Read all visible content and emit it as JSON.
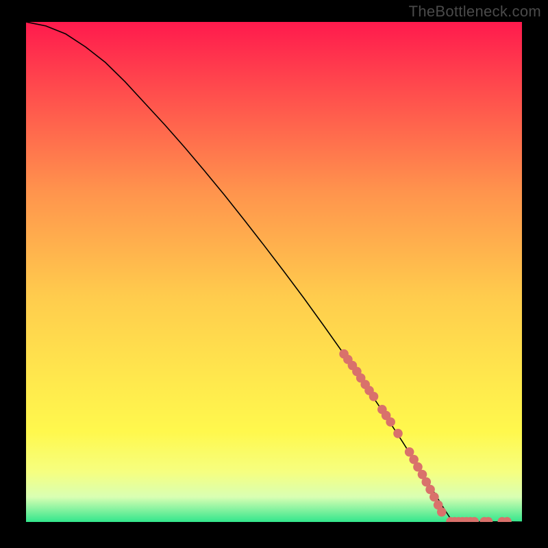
{
  "watermark": "TheBottleneck.com",
  "colors": {
    "bg_black": "#000000",
    "grad_top": "#ff1a4d",
    "grad_mid1": "#ff4d4d",
    "grad_mid2": "#ff944d",
    "grad_mid3": "#ffcc4d",
    "grad_mid4": "#ffe94d",
    "grad_mid5": "#fff84d",
    "grad_mid6": "#f6ff80",
    "grad_mid7": "#d9ffb3",
    "grad_bottom": "#33e68c",
    "curve": "#000000",
    "dots": "#d9716b"
  },
  "chart_data": {
    "type": "line",
    "title": "",
    "xlabel": "",
    "ylabel": "",
    "x_range": [
      0,
      100
    ],
    "y_range": [
      0,
      100
    ],
    "curve": [
      [
        0,
        100
      ],
      [
        4,
        99.2
      ],
      [
        8,
        97.6
      ],
      [
        12,
        95.0
      ],
      [
        16,
        91.9
      ],
      [
        20,
        88.0
      ],
      [
        24,
        83.7
      ],
      [
        28,
        79.4
      ],
      [
        32,
        74.9
      ],
      [
        36,
        70.2
      ],
      [
        40,
        65.4
      ],
      [
        44,
        60.4
      ],
      [
        48,
        55.3
      ],
      [
        52,
        50.1
      ],
      [
        56,
        44.8
      ],
      [
        60,
        39.3
      ],
      [
        64,
        33.7
      ],
      [
        68,
        27.9
      ],
      [
        72,
        22.0
      ],
      [
        76,
        15.9
      ],
      [
        80,
        9.6
      ],
      [
        82,
        6.4
      ],
      [
        84,
        3.1
      ],
      [
        85.5,
        0.8
      ],
      [
        86,
        0.3
      ],
      [
        88,
        0.1
      ],
      [
        92,
        0.05
      ],
      [
        96,
        0.02
      ],
      [
        100,
        0.0
      ]
    ],
    "upper_dot_cluster": [
      [
        64.1,
        33.6
      ],
      [
        64.9,
        32.5
      ],
      [
        65.8,
        31.3
      ],
      [
        66.7,
        30.1
      ],
      [
        67.5,
        28.8
      ],
      [
        68.4,
        27.5
      ],
      [
        69.2,
        26.3
      ],
      [
        70.1,
        25.1
      ],
      [
        71.8,
        22.5
      ],
      [
        72.6,
        21.3
      ],
      [
        73.5,
        20.0
      ],
      [
        75.0,
        17.7
      ],
      [
        77.3,
        14.0
      ],
      [
        78.2,
        12.5
      ],
      [
        79.0,
        11.0
      ],
      [
        79.9,
        9.5
      ],
      [
        80.7,
        8.0
      ],
      [
        81.5,
        6.5
      ],
      [
        82.3,
        5.0
      ],
      [
        83.1,
        3.4
      ],
      [
        83.8,
        2.0
      ]
    ],
    "baseline_dots": [
      [
        85.6,
        0.1
      ],
      [
        86.4,
        0.1
      ],
      [
        87.2,
        0.1
      ],
      [
        88.0,
        0.1
      ],
      [
        88.8,
        0.1
      ],
      [
        89.6,
        0.1
      ],
      [
        90.4,
        0.1
      ],
      [
        92.4,
        0.1
      ],
      [
        93.2,
        0.1
      ],
      [
        96.0,
        0.1
      ],
      [
        97.0,
        0.1
      ]
    ]
  }
}
